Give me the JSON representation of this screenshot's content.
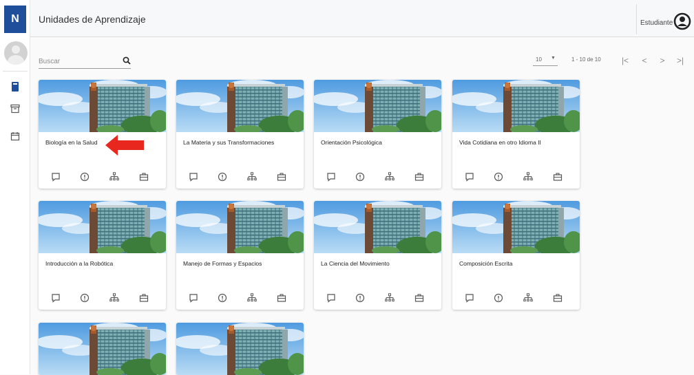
{
  "app": {
    "logo_letter": "N"
  },
  "header": {
    "title": "Unidades de Aprendizaje",
    "role": "Estudiante"
  },
  "search": {
    "placeholder": "Buscar",
    "value": ""
  },
  "pagination": {
    "page_size": "10",
    "range": "1 - 10 de 10"
  },
  "sidebar": {
    "items": [
      {
        "icon": "book-icon"
      },
      {
        "icon": "archive-icon"
      },
      {
        "icon": "calendar-icon"
      }
    ]
  },
  "colors": {
    "brand": "#1f4e9a",
    "arrow": "#e8281e"
  },
  "cards": [
    {
      "title": "Biología en la Salud"
    },
    {
      "title": "La Materia y sus Transformaciones"
    },
    {
      "title": "Orientación Psicológica"
    },
    {
      "title": "Vida Cotidiana en otro Idioma II"
    },
    {
      "title": "Introducción a la Robótica"
    },
    {
      "title": "Manejo de Formas y Espacios"
    },
    {
      "title": "La Ciencia del Movimiento"
    },
    {
      "title": "Composición Escrita"
    },
    {
      "title": ""
    },
    {
      "title": ""
    }
  ],
  "card_actions": [
    "comment-icon",
    "info-icon",
    "hierarchy-icon",
    "briefcase-icon"
  ]
}
